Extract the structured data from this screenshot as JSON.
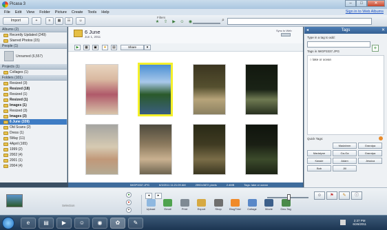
{
  "window": {
    "title": "Picasa 3",
    "controls": [
      "–",
      "□",
      "✕"
    ]
  },
  "menu": {
    "items": [
      "File",
      "Edit",
      "View",
      "Folder",
      "Picture",
      "Create",
      "Tools",
      "Help"
    ],
    "signin": "Sign in to Web Albums"
  },
  "toolbar": {
    "import": "Import",
    "filters": "Filters"
  },
  "left": {
    "albums_header": "Albums (2)",
    "albums": [
      "Recently Updated (249)",
      "Starred Photos (15)"
    ],
    "people_header": "People (1)",
    "people_item": "Unnamed (6,557)",
    "projects_header": "Projects (1)",
    "projects": [
      "Collages (1)"
    ],
    "folders_header": "Folders (101)",
    "folders": [
      {
        "label": "Resized (3)",
        "bold": false
      },
      {
        "label": "Resized (18)",
        "bold": true
      },
      {
        "label": "Resized (1)",
        "bold": false
      },
      {
        "label": "Resized (1)",
        "bold": true
      },
      {
        "label": "Images (1)",
        "bold": true
      },
      {
        "label": "Resized (3)",
        "bold": false
      },
      {
        "label": "Images (3)",
        "bold": true
      },
      {
        "label": "6 June (339)",
        "bold": true,
        "selected": true
      },
      {
        "label": "Old Scans (2)",
        "bold": false
      },
      {
        "label": "Dress (1)",
        "bold": false
      },
      {
        "label": "5May (11)",
        "bold": false
      },
      {
        "label": "4April (165)",
        "bold": false
      },
      {
        "label": "1999 (2)",
        "bold": false
      },
      {
        "label": "2002 (4)",
        "bold": false
      },
      {
        "label": "2001 (1)",
        "bold": false
      },
      {
        "label": "2004 (4)",
        "bold": false
      }
    ]
  },
  "center": {
    "folder_title": "6 June",
    "folder_date": "Jun 1, 2011",
    "sync_label": "Sync to Web",
    "share_label": "Share",
    "status": {
      "filename": "IMGP3337.JPG",
      "datetime": "6/3/2011 11:21:09 AM",
      "dimensions": "2592x3872 pixels",
      "size": "2.4MB",
      "tags": "Tags: lake or ocean"
    }
  },
  "right": {
    "title": "Tags",
    "type_label": "Type in a tag to add:",
    "tags_in_label": "Tags in IMGP3337.JPG",
    "tag_items": [
      "lake or ocean"
    ],
    "quick_label": "Quick Tags:",
    "quick_tags": [
      "Madahnm",
      "Grandpa",
      "Madalyne",
      "Ga-Ga",
      "Grandpa",
      "Kassie",
      "Adam",
      "Jessica",
      "Bob",
      "Jill"
    ]
  },
  "bottom": {
    "selection_label": "Selection",
    "actions": [
      "Upload",
      "Email",
      "Print",
      "Export",
      "Shop",
      "BlogThis!",
      "Collage",
      "Movie",
      "Geo-Tag"
    ]
  },
  "taskbar": {
    "time": "2:37 PM",
    "date": "6/26/2011"
  }
}
